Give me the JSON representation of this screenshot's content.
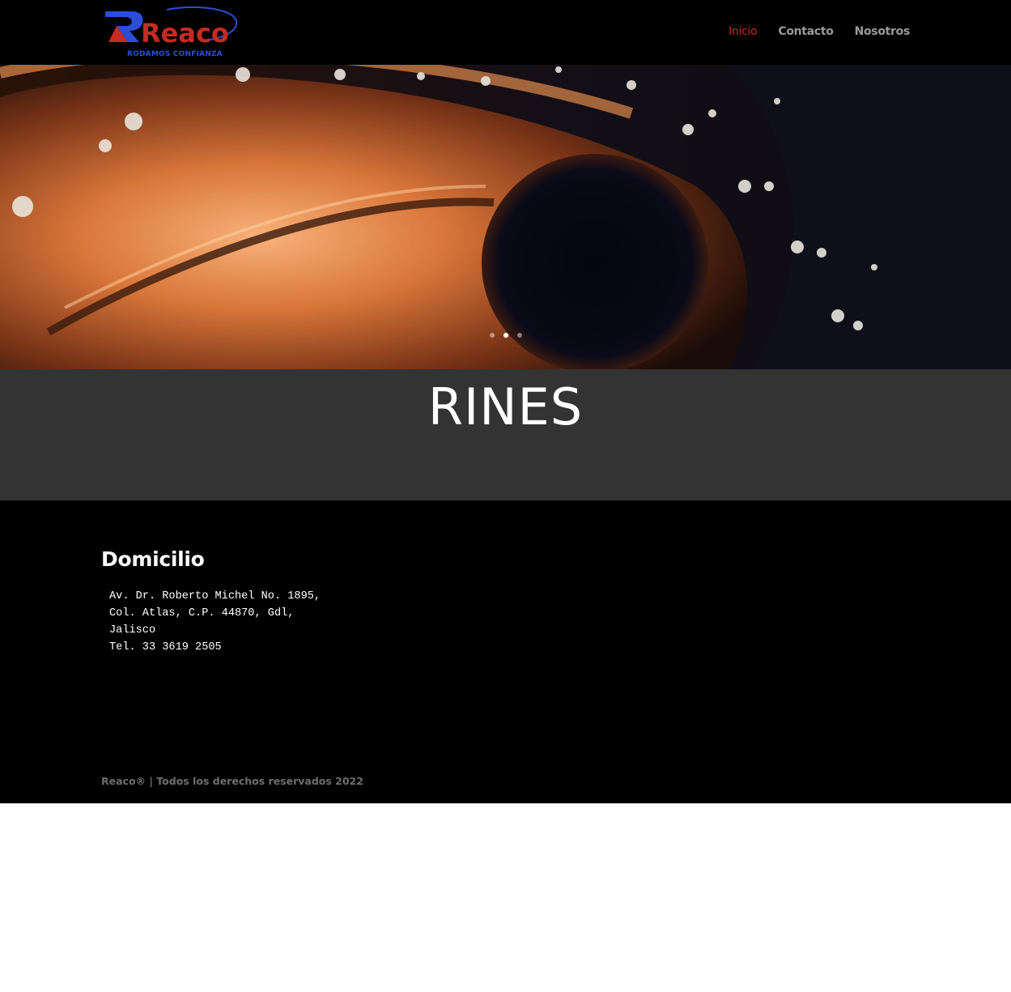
{
  "brand": {
    "name": "Reaco",
    "tagline": "RODAMOS CONFIANZA",
    "colors": {
      "red": "#c62a22",
      "blue": "#2a4fd6"
    }
  },
  "nav": {
    "items": [
      {
        "label": "Inicio",
        "active": true
      },
      {
        "label": "Contacto",
        "active": false
      },
      {
        "label": "Nosotros",
        "active": false
      }
    ]
  },
  "slider": {
    "slide_count": 3,
    "active_slide": 2,
    "title": "RINES"
  },
  "footer": {
    "heading": "Domicilio",
    "address_lines": [
      "Av. Dr. Roberto Michel No. 1895,",
      "Col. Atlas, C.P. 44870, Gdl,",
      "Jalisco",
      "Tel. 33 3619 2505"
    ],
    "copyright": "Reaco® | Todos los derechos reservados 2022"
  }
}
